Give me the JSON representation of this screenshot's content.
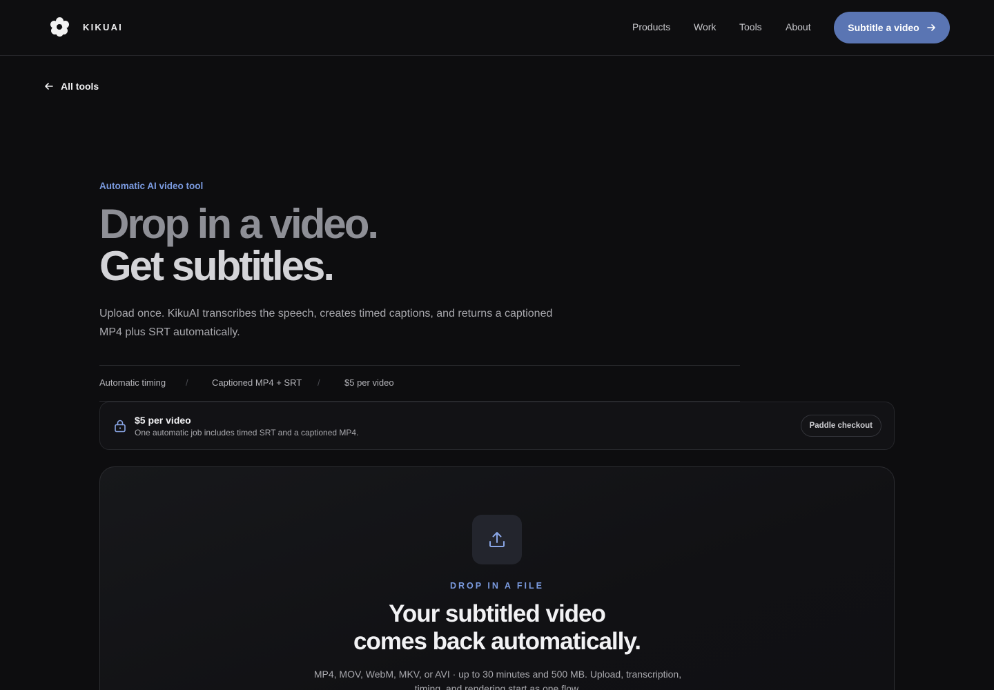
{
  "brand": {
    "name": "KIKUAI",
    "logo_icon": "flower-logo-icon"
  },
  "nav": {
    "items": [
      {
        "label": "Products"
      },
      {
        "label": "Work"
      },
      {
        "label": "Tools"
      },
      {
        "label": "About"
      }
    ],
    "cta_label": "Subtitle a video",
    "cta_color": "#5a75b3"
  },
  "back_link": {
    "label": "All tools"
  },
  "hero": {
    "eyebrow": "Automatic AI video tool",
    "title_line1": "Drop in a video.",
    "title_line2": "Get subtitles.",
    "lede": "Upload once. KikuAI transcribes the speech, creates timed captions, and returns a captioned MP4 plus SRT automatically.",
    "features": [
      "Automatic timing",
      "Captioned MP4 + SRT",
      "$5 per video"
    ],
    "separator": "/"
  },
  "pricing": {
    "title": "$5 per video",
    "subtitle": "One automatic job includes timed SRT and a captioned MP4.",
    "button_label": "Paddle checkout"
  },
  "dropzone": {
    "eyebrow": "DROP IN A FILE",
    "title_line1": "Your subtitled video",
    "title_line2": "comes back automatically.",
    "subtitle": "MP4, MOV, WebM, MKV, or AVI · up to 30 minutes and 500 MB. Upload, transcription, timing, and rendering start as one flow."
  },
  "accent_color": "#7b9be0"
}
